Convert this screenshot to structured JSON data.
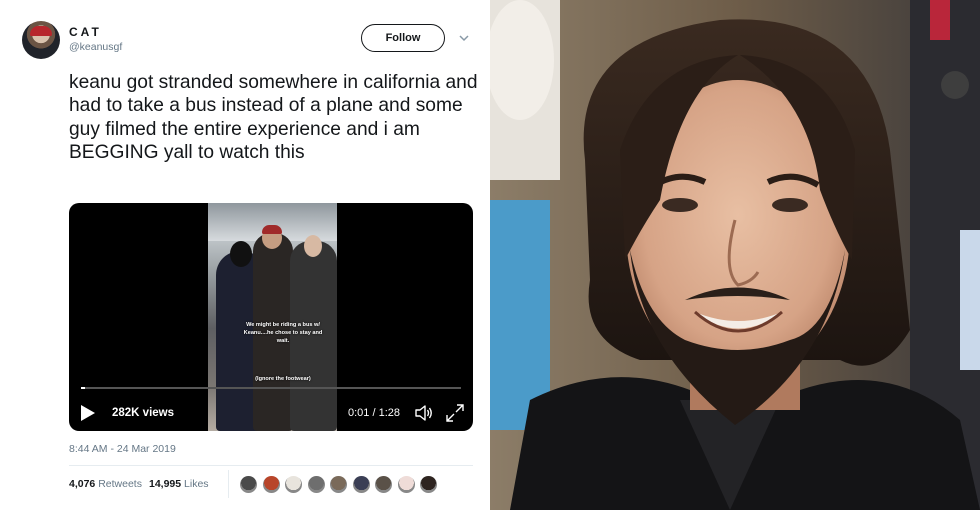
{
  "tweet": {
    "display_name": "CAT",
    "handle": "@keanusgf",
    "follow_label": "Follow",
    "text": "keanu got stranded somewhere in california and had to take a bus instead of a plane and some guy filmed the entire experience and i am BEGGING yall to watch this",
    "video": {
      "caption_primary": "We might be riding a bus w/ Keanu....he chose to stay and wait.",
      "caption_secondary": "(Ignore the footwear)",
      "views": "282K views",
      "timecode": "0:01 / 1:28",
      "progress": 0.01,
      "play_icon": "play-icon",
      "volume_icon": "volume-icon",
      "fullscreen_icon": "fullscreen-icon"
    },
    "timestamp": "8:44 AM - 24 Mar 2019",
    "stats": {
      "retweets_count": "4,076",
      "retweets_label": "Retweets",
      "likes_count": "14,995",
      "likes_label": "Likes"
    },
    "liker_avatar_colors": [
      "#4a4a4a",
      "#b8452a",
      "#e8e4dd",
      "#6e6e6e",
      "#7a6a5a",
      "#3b3f55",
      "#5a5148",
      "#efdcd8",
      "#2e2420"
    ]
  },
  "colors": {
    "text_primary": "#14171a",
    "text_secondary": "#657786",
    "divider": "#e6ecf0"
  }
}
